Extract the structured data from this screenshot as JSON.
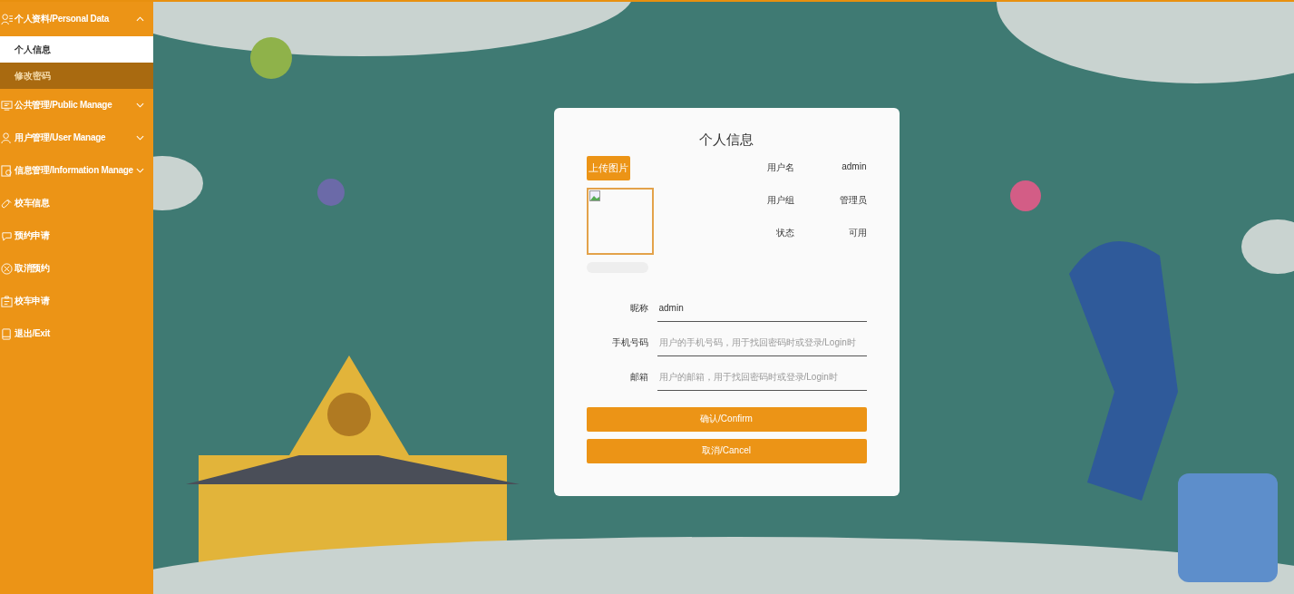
{
  "sidebar": {
    "items": [
      {
        "kind": "group",
        "label": "个人资料/Personal Data",
        "expanded": true,
        "children": [
          {
            "label": "个人信息",
            "selected": true
          },
          {
            "label": "修改密码",
            "selected": false
          }
        ]
      },
      {
        "kind": "group",
        "label": "公共管理/Public Manage",
        "expanded": false
      },
      {
        "kind": "group",
        "label": "用户管理/User Manage",
        "expanded": false
      },
      {
        "kind": "group",
        "label": "信息管理/Information Manage",
        "expanded": false
      },
      {
        "kind": "link",
        "label": "校车信息"
      },
      {
        "kind": "link",
        "label": "预约申请"
      },
      {
        "kind": "link",
        "label": "取消预约"
      },
      {
        "kind": "link",
        "label": "校车申请"
      },
      {
        "kind": "link",
        "label": "退出/Exit"
      }
    ]
  },
  "profile": {
    "title": "个人信息",
    "upload_button": "上传图片",
    "info": [
      {
        "label": "用户名",
        "value": "admin"
      },
      {
        "label": "用户组",
        "value": "管理员"
      },
      {
        "label": "状态",
        "value": "可用"
      }
    ],
    "fields": [
      {
        "label": "昵称",
        "value": "admin"
      },
      {
        "label": "手机号码",
        "placeholder": "用户的手机号码，用于找回密码时或登录/Login时"
      },
      {
        "label": "邮箱",
        "placeholder": "用户的邮箱，用于找回密码时或登录/Login时"
      }
    ],
    "buttons": [
      "确认/Confirm",
      "取消/Cancel"
    ]
  }
}
